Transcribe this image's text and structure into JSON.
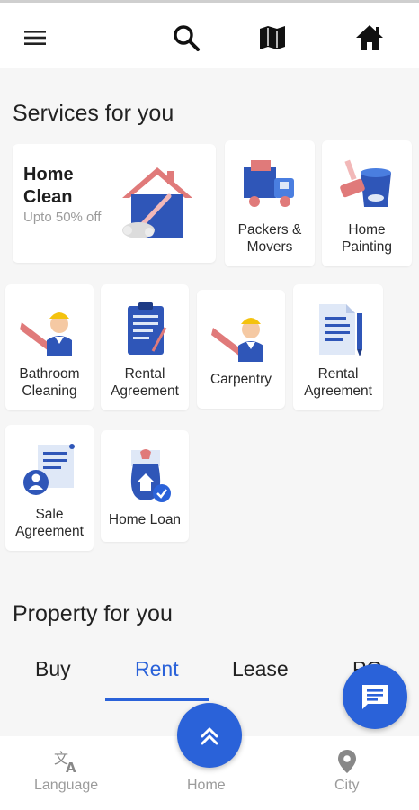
{
  "header": {
    "menu_icon": "menu-icon",
    "search_icon": "search-icon",
    "map_icon": "map-icon",
    "home_icon": "home-icon"
  },
  "services": {
    "title": "Services for you",
    "hero": {
      "title": "Home\nClean",
      "subtitle": "Upto 50% off",
      "icon": "house-cleaning-icon"
    },
    "items": [
      {
        "label": "Packers &\nMovers",
        "icon": "moving-truck-icon"
      },
      {
        "label": "Home\nPainting",
        "icon": "paint-bucket-icon"
      },
      {
        "label": "Bathroom\nCleaning",
        "icon": "worker-saw-icon"
      },
      {
        "label": "Rental\nAgreement",
        "icon": "clipboard-document-icon"
      },
      {
        "label": "Carpentry",
        "icon": "worker-saw-icon"
      },
      {
        "label": "Rental\nAgreement",
        "icon": "document-pen-icon"
      },
      {
        "label": "Sale\nAgreement",
        "icon": "document-user-icon"
      },
      {
        "label": "Home Loan",
        "icon": "money-bag-house-icon"
      }
    ]
  },
  "property": {
    "title": "Property for you",
    "tabs": [
      "Buy",
      "Rent",
      "Lease",
      "PG"
    ],
    "active_tab": "Rent"
  },
  "bottom_nav": {
    "items": [
      {
        "label": "Language",
        "icon": "translate-icon"
      },
      {
        "label": "Home",
        "icon": "home-fab-icon"
      },
      {
        "label": "City",
        "icon": "location-pin-icon"
      }
    ]
  },
  "colors": {
    "accent": "#2a62d9",
    "muted": "#9b9b9b",
    "background": "#f6f6f6"
  }
}
